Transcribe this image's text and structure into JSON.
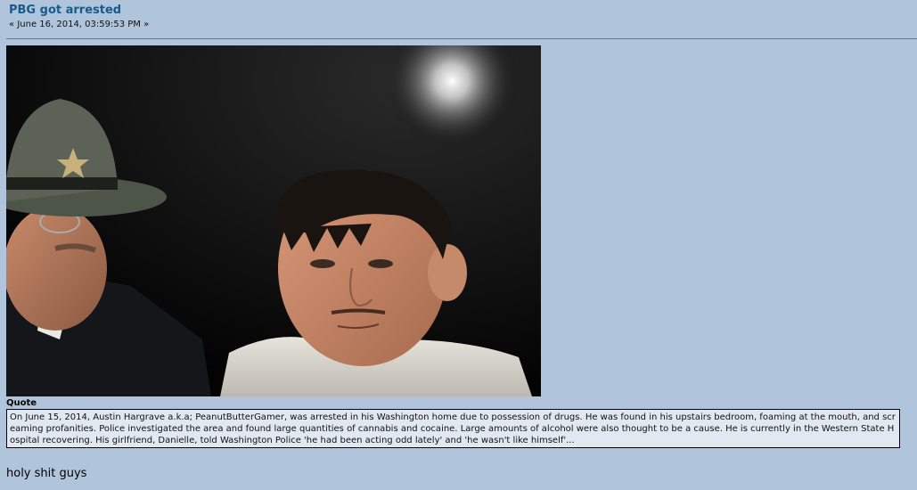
{
  "post": {
    "title": "PBG got arrested",
    "date_prefix": "«",
    "date": "June 16, 2014, 03:59:53 PM",
    "date_suffix": "»",
    "quote_label": "Quote",
    "quote_text": "On June 15, 2014, Austin Hargrave a.k.a; PeanutButterGamer, was arrested in his Washington home due to possession of drugs. He was found in his upstairs bedroom, foaming at the mouth, and screaming profanities. Police investigated the area and found large quantities of cannabis and cocaine. Large amounts of alcohol were also thought to be a cause. He is currently in the Western State Hospital recovering. His girlfriend, Danielle, told Washington Police 'he had been acting odd lately' and 'he wasn't like himself'...",
    "body_text": "holy shit guys"
  },
  "colors": {
    "page_background": "#b0c5dc",
    "title_link": "#1a5a8a",
    "quote_background": "#e1e8f2"
  }
}
